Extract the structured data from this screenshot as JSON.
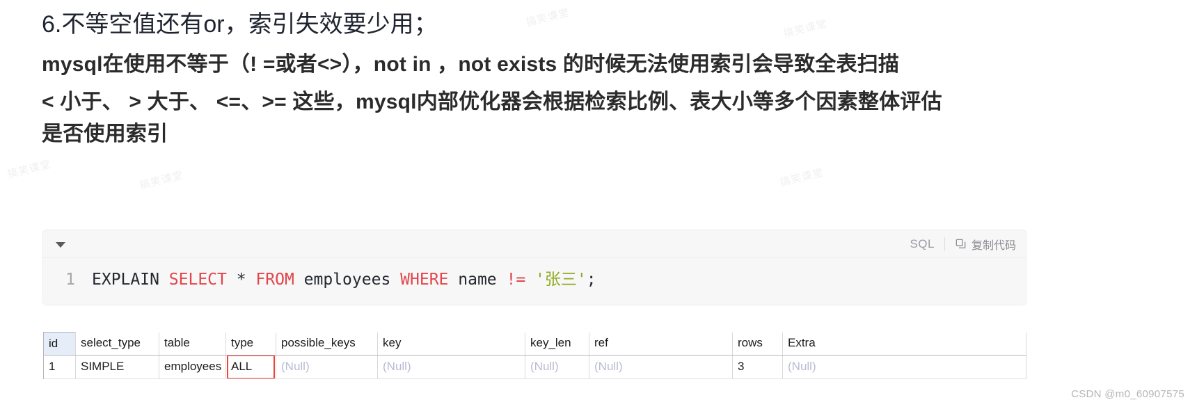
{
  "article": {
    "heading": "6.不等空值还有or，索引失效要少用；",
    "paragraph_lines": [
      "mysql在使用不等于（! =或者<>），not in ，not exists 的时候无法使用索引会导致全表扫描",
      "< 小于、 > 大于、 <=、>= 这些，mysql内部优化器会根据检索比例、表大小等多个因素整体评估",
      "是否使用索引"
    ]
  },
  "code_block": {
    "collapse_icon": "triangle-down-icon",
    "language_label": "SQL",
    "copy_icon": "copy-icon",
    "copy_label": "复制代码",
    "line_number": "1",
    "tokens": [
      {
        "text": "EXPLAIN ",
        "kind": "plain"
      },
      {
        "text": "SELECT ",
        "kind": "keyword"
      },
      {
        "text": "* ",
        "kind": "plain"
      },
      {
        "text": "FROM ",
        "kind": "keyword"
      },
      {
        "text": "employees ",
        "kind": "plain"
      },
      {
        "text": "WHERE ",
        "kind": "keyword"
      },
      {
        "text": "name ",
        "kind": "plain"
      },
      {
        "text": "!= ",
        "kind": "operator"
      },
      {
        "text": "'张三'",
        "kind": "string"
      },
      {
        "text": ";",
        "kind": "plain"
      }
    ],
    "full_code": "EXPLAIN SELECT * FROM employees WHERE name != '张三';"
  },
  "explain_result": {
    "columns": [
      "id",
      "select_type",
      "table",
      "type",
      "possible_keys",
      "key",
      "key_len",
      "ref",
      "rows",
      "Extra"
    ],
    "rows": [
      {
        "id": "1",
        "select_type": "SIMPLE",
        "table": "employees",
        "type": "ALL",
        "possible_keys": "(Null)",
        "key": "(Null)",
        "key_len": "(Null)",
        "ref": "(Null)",
        "rows": "3",
        "Extra": "(Null)"
      }
    ],
    "highlighted_cell": "type",
    "highlight_color": "#e8453c",
    "null_text": "(Null)"
  },
  "watermark": {
    "text": "搞笑课堂",
    "credit": "CSDN @m0_60907575"
  }
}
